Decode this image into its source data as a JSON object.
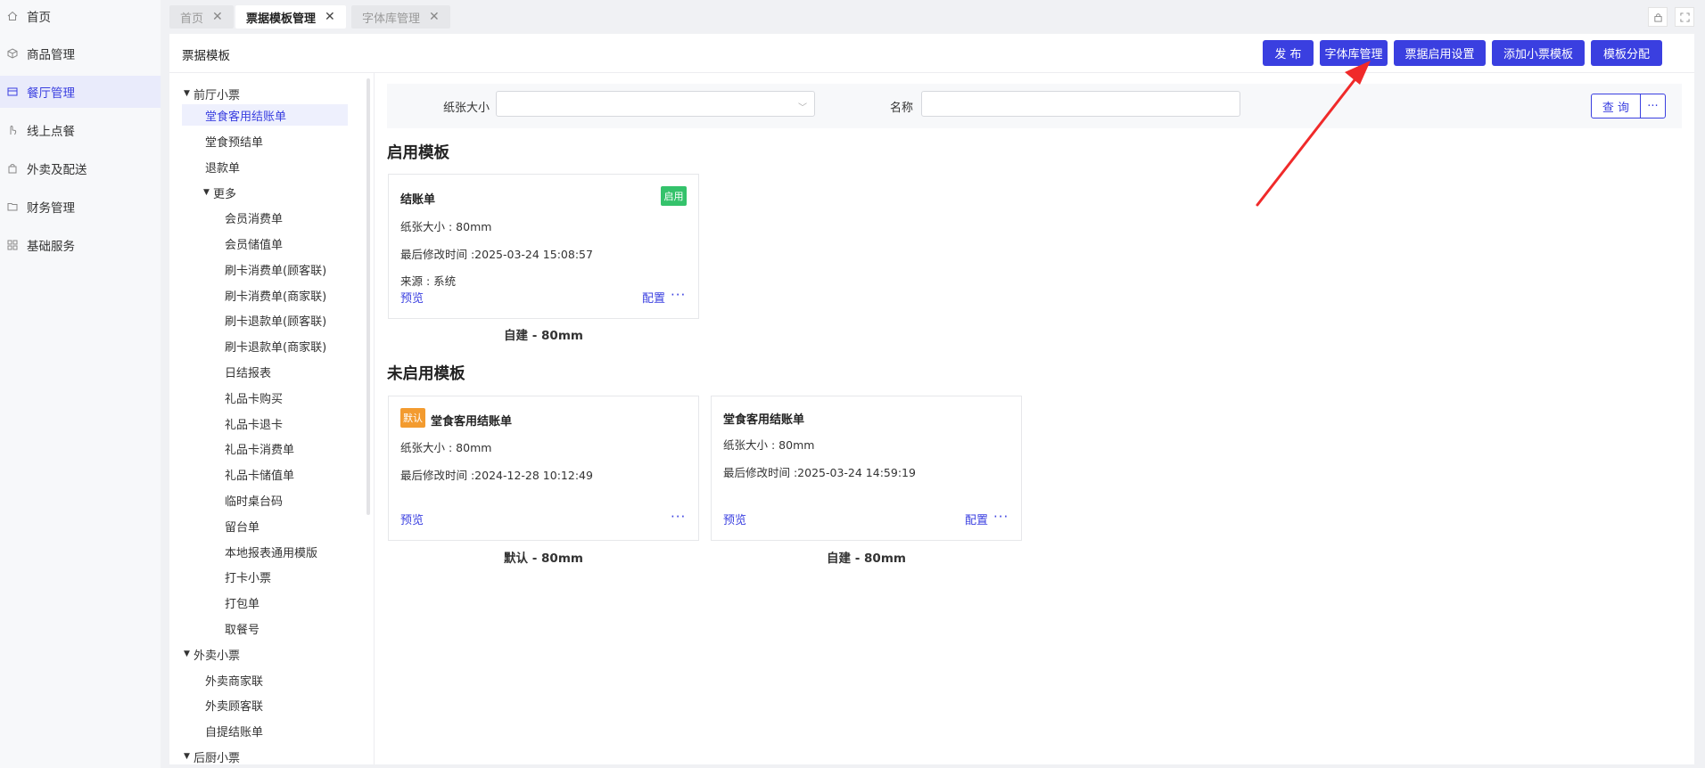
{
  "nav": {
    "items": [
      {
        "label": "首页",
        "icon": "home-icon"
      },
      {
        "label": "商品管理",
        "icon": "box-icon"
      },
      {
        "label": "餐厅管理",
        "icon": "restaurant-icon"
      },
      {
        "label": "线上点餐",
        "icon": "hand-icon"
      },
      {
        "label": "外卖及配送",
        "icon": "bag-icon"
      },
      {
        "label": "财务管理",
        "icon": "folder-icon"
      },
      {
        "label": "基础服务",
        "icon": "grid-icon"
      }
    ],
    "active": "餐厅管理"
  },
  "tabs": [
    {
      "label": "首页",
      "active": false
    },
    {
      "label": "票据模板管理",
      "active": true
    },
    {
      "label": "字体库管理",
      "active": false
    }
  ],
  "close_glyph": "✕",
  "header": {
    "title": "票据模板",
    "buttons": {
      "publish": "发 布",
      "font_lib": "字体库管理",
      "enable_settings": "票据启用设置",
      "add_template": "添加小票模板",
      "assign": "模板分配"
    }
  },
  "tree": {
    "group1": "前厅小票",
    "group1_items": [
      "堂食客用结账单",
      "堂食预结单",
      "退款单"
    ],
    "more": "更多",
    "more_items": [
      "会员消费单",
      "会员储值单",
      "刷卡消费单(顾客联)",
      "刷卡消费单(商家联)",
      "刷卡退款单(顾客联)",
      "刷卡退款单(商家联)",
      "日结报表",
      "礼品卡购买",
      "礼品卡退卡",
      "礼品卡消费单",
      "礼品卡储值单",
      "临时桌台码",
      "留台单",
      "本地报表通用模版",
      "打卡小票",
      "打包单",
      "取餐号"
    ],
    "group2": "外卖小票",
    "group2_items": [
      "外卖商家联",
      "外卖顾客联",
      "自提结账单"
    ],
    "group3": "后厨小票",
    "selected": "堂食客用结账单"
  },
  "filter": {
    "paper_label": "纸张大小",
    "paper_value": "",
    "name_label": "名称",
    "name_value": "",
    "query": "查 询",
    "more": "···"
  },
  "enabled": {
    "title": "启用模板",
    "cards": [
      {
        "name": "结账单",
        "badge": "启用",
        "paper": "纸张大小 : 80mm",
        "modified": "最后修改时间 :2025-03-24 15:08:57",
        "source": "来源 : 系统",
        "preview": "预览",
        "config": "配置",
        "more": "···",
        "caption": "自建 - 80mm"
      }
    ]
  },
  "disabled": {
    "title": "未启用模板",
    "cards": [
      {
        "badge": "默认",
        "name": "堂食客用结账单",
        "paper": "纸张大小 : 80mm",
        "modified": "最后修改时间 :2024-12-28 10:12:49",
        "preview": "预览",
        "more": "···",
        "caption": "默认 - 80mm"
      },
      {
        "name": "堂食客用结账单",
        "paper": "纸张大小 : 80mm",
        "modified": "最后修改时间 :2025-03-24 14:59:19",
        "preview": "预览",
        "config": "配置",
        "more": "···",
        "caption": "自建 - 80mm"
      }
    ]
  },
  "colors": {
    "primary": "#3a3fe0",
    "enabled_badge": "#34c26b",
    "default_badge": "#f39b2f",
    "annotation_arrow": "#f02a2a"
  }
}
